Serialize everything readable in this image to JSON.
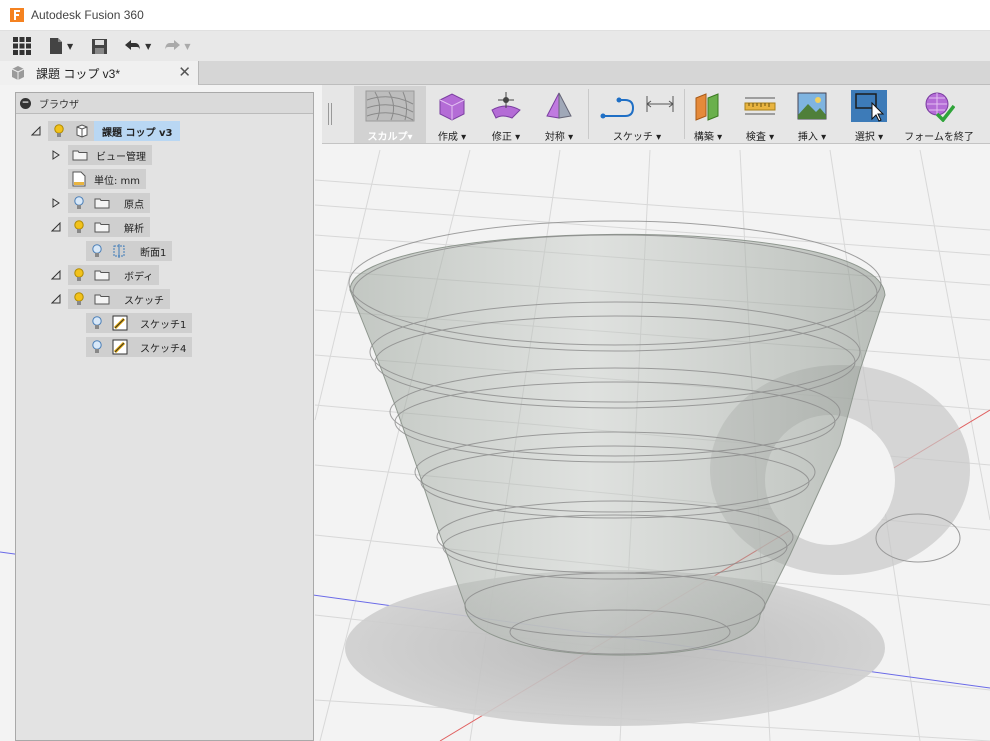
{
  "app": {
    "title": "Autodesk Fusion 360"
  },
  "document_tab": {
    "name": "課題 コップ v3*"
  },
  "browser": {
    "title": "ブラウザ",
    "items": [
      {
        "label": "課題 コップ v3"
      },
      {
        "label": "ビュー管理"
      },
      {
        "label": "単位: mm"
      },
      {
        "label": "原点"
      },
      {
        "label": "解析"
      },
      {
        "label": "断面1"
      },
      {
        "label": "ボディ"
      },
      {
        "label": "スケッチ"
      },
      {
        "label": "スケッチ1"
      },
      {
        "label": "スケッチ4"
      }
    ]
  },
  "ribbon": {
    "workspace": "スカルプ▾",
    "tools": [
      {
        "label": "作成 ▾",
        "icon": "create-box-icon"
      },
      {
        "label": "修正 ▾",
        "icon": "modify-icon"
      },
      {
        "label": "対称 ▾",
        "icon": "symmetry-icon"
      },
      {
        "label": "スケッチ ▾",
        "icon": "sketch-icon"
      },
      {
        "label": "構築 ▾",
        "icon": "construct-plane-icon"
      },
      {
        "label": "検査 ▾",
        "icon": "inspect-ruler-icon"
      },
      {
        "label": "挿入 ▾",
        "icon": "insert-image-icon"
      },
      {
        "label": "選択 ▾",
        "icon": "select-cursor-icon"
      },
      {
        "label": "フォームを終了",
        "icon": "finish-form-icon"
      }
    ]
  },
  "colors": {
    "accent": "#3d7bb8",
    "selected_node": "#b9d7f3",
    "bulb_on": "#f2c21b",
    "bulb_off": "#7aa7d6",
    "x_axis": "#e06060",
    "y_axis": "#5a5ae0"
  }
}
